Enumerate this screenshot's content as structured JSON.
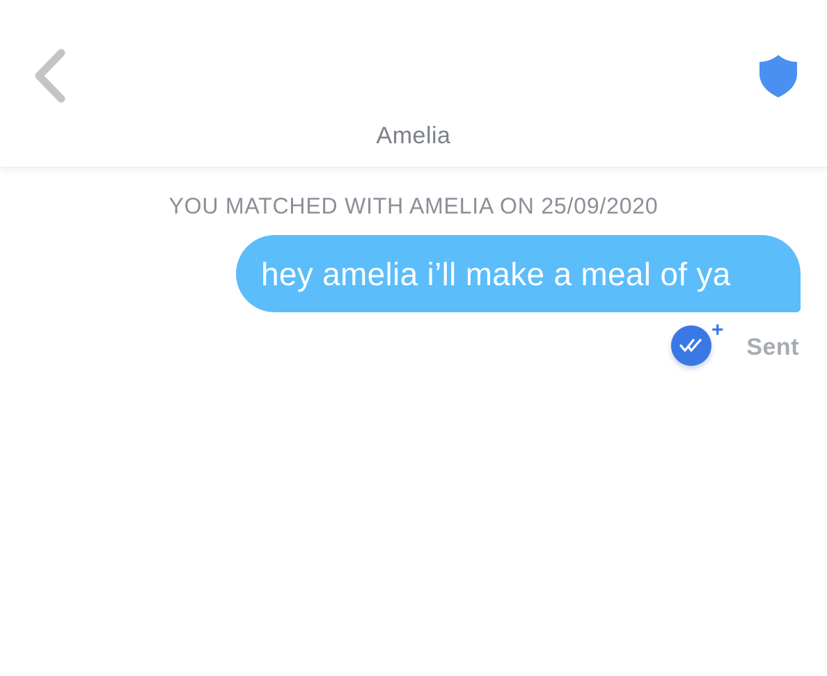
{
  "header": {
    "title": "Amelia",
    "back_icon": "chevron-left-icon",
    "safety_icon": "shield-icon"
  },
  "chat": {
    "match_banner": "YOU MATCHED WITH AMELIA ON 25/09/2020",
    "messages": [
      {
        "text": "hey amelia i’ll make a meal of ya",
        "status": "Sent",
        "status_icon": "double-check-icon",
        "status_plus": "+"
      }
    ]
  },
  "colors": {
    "bubble": "#5bbdfa",
    "accent": "#3a78e6",
    "shield": "#4a90f0",
    "back": "#c4c4c4"
  }
}
